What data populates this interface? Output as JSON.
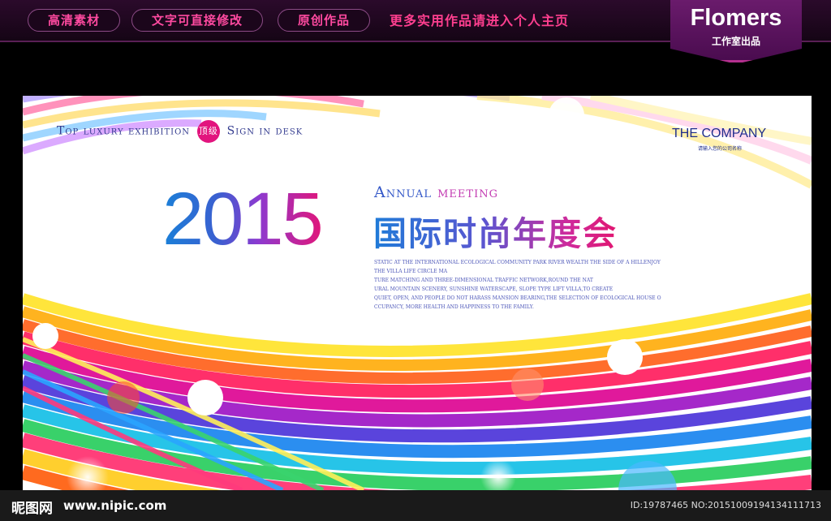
{
  "top_bar": {
    "pills": [
      "高清素材",
      "文字可直接修改",
      "原创作品"
    ],
    "link": "更多实用作品请进入个人主页",
    "badge_title": "Flomers",
    "badge_sub": "工作室出品"
  },
  "poster": {
    "lux_line_part1": "Top luxury exhibition",
    "lux_badge": "顶级",
    "lux_line_part2": "Sign in desk",
    "company": "THE COMPANY",
    "company_sub": "请输入您的公司名称",
    "year": "2015",
    "annual_word1": "Annual",
    "annual_word2": "meeting",
    "cn_title": "国际时尚年度会",
    "body_lines": [
      "STATIC AT THE INTERNATIONAL ECOLOGICAL COMMUNITY PARK RIVER WEALTH THE SIDE OF A HILLENJOY",
      "THE VILLA LIFE CIRCLE MA",
      "TURE MATCHING AND THREE-DIMENSIONAL TRAFFIC NETWORK,ROUND THE NAT",
      "URAL MOUNTAIN SCENERY, SUNSHINE WATERSCAPE, SLOPE TYPE LIFT VILLA,TO CREATE",
      "QUIET, OPEN, AND PEOPLE DO NOT HARASS MANSION BEARING,THE SELECTION OF ECOLOGICAL HOUSE O",
      "CCUPANCY, MORE HEALTH AND HAPPINESS TO THE FAMILY."
    ]
  },
  "footer": {
    "logo": "昵图网",
    "site": "www.nipic.com",
    "image_id": "ID:19787465 NO:20151009194134111713"
  },
  "colors": {
    "accent_pink": "#e2147e",
    "navy": "#1e2e8c"
  }
}
